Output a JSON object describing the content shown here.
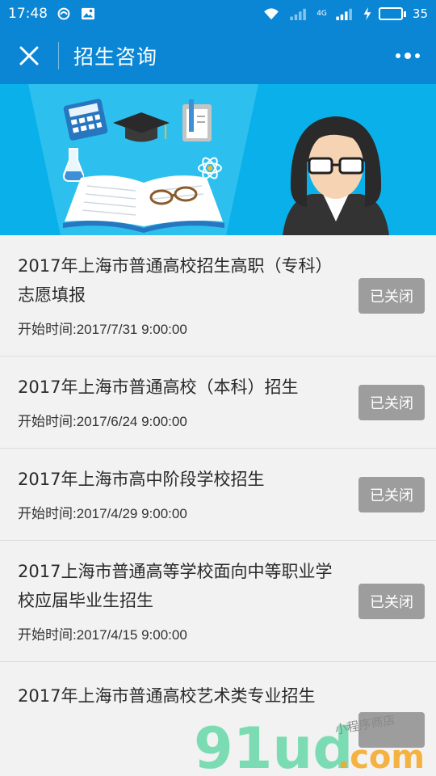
{
  "status_bar": {
    "time": "17:48",
    "network": "4G",
    "battery": "35",
    "battery_level": 0.35
  },
  "nav": {
    "title": "招生咨询"
  },
  "items": [
    {
      "title": "2017年上海市普通高校招生高职（专科）志愿填报",
      "time": "开始时间:2017/7/31 9:00:00",
      "status": "已关闭"
    },
    {
      "title": "2017年上海市普通高校（本科）招生",
      "time": "开始时间:2017/6/24 9:00:00",
      "status": "已关闭"
    },
    {
      "title": "2017年上海市高中阶段学校招生",
      "time": "开始时间:2017/4/29 9:00:00",
      "status": "已关闭"
    },
    {
      "title": "2017上海市普通高等学校面向中等职业学校应届毕业生招生",
      "time": "开始时间:2017/4/15 9:00:00",
      "status": "已关闭"
    },
    {
      "title": "2017年上海市普通高校艺术类专业招生",
      "time": "",
      "status": ""
    }
  ],
  "watermark": {
    "brand": "91ud",
    "suffix": ".com",
    "tagline": "小程序商店"
  },
  "colors": {
    "primary": "#0a86d4",
    "banner": "#0ab0e9",
    "button_gray": "#9d9d9d"
  }
}
